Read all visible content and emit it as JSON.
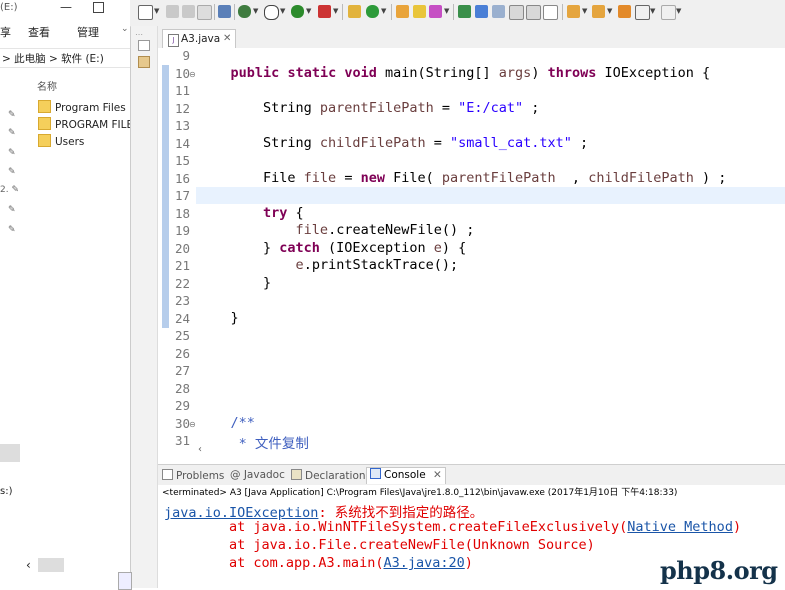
{
  "explorer": {
    "title": "(E:)",
    "ribbon": [
      "享",
      "查看",
      "管理"
    ],
    "breadcrumb": "> 此电脑 > 软件 (E:)",
    "column_name": "名称",
    "folders": [
      "Program Files",
      "PROGRAM FILES",
      "Users"
    ],
    "side_label_2": "2.",
    "side_label_s": "s:)"
  },
  "editor": {
    "tab_label": "A3.java",
    "lines": [
      {
        "n": "9",
        "code": ""
      },
      {
        "n": "10",
        "code": "public static void main(String[] args) throws IOException {"
      },
      {
        "n": "11",
        "code": ""
      },
      {
        "n": "12",
        "code": "    String parentFilePath = \"E:/cat\" ;"
      },
      {
        "n": "13",
        "code": ""
      },
      {
        "n": "14",
        "code": "    String childFilePath = \"small_cat.txt\" ;"
      },
      {
        "n": "15",
        "code": ""
      },
      {
        "n": "16",
        "code": "    File file = new File( parentFilePath  , childFilePath ) ;"
      },
      {
        "n": "17",
        "code": ""
      },
      {
        "n": "18",
        "code": "    try {"
      },
      {
        "n": "19",
        "code": "        file.createNewFile() ;"
      },
      {
        "n": "20",
        "code": "    } catch (IOException e) {"
      },
      {
        "n": "21",
        "code": "        e.printStackTrace();"
      },
      {
        "n": "22",
        "code": "    }"
      },
      {
        "n": "23",
        "code": ""
      },
      {
        "n": "24",
        "code": "}"
      },
      {
        "n": "25",
        "code": ""
      },
      {
        "n": "26",
        "code": ""
      },
      {
        "n": "27",
        "code": ""
      },
      {
        "n": "28",
        "code": ""
      },
      {
        "n": "29",
        "code": ""
      },
      {
        "n": "30",
        "code": "/**"
      },
      {
        "n": "31",
        "code": " * 文件复制"
      }
    ]
  },
  "console": {
    "tabs": {
      "problems": "Problems",
      "javadoc": "@ Javadoc",
      "declaration": "Declaration",
      "console": "Console"
    },
    "status": "<terminated> A3 [Java Application] C:\\Program Files\\Java\\jre1.8.0_112\\bin\\javaw.exe (2017年1月10日 下午4:18:33)",
    "exception_class": "java.io.IOException",
    "exception_msg": ": 系统找不到指定的路径。",
    "trace1_prefix": "        at java.io.WinNTFileSystem.createFileExclusively(",
    "trace1_link": "Native Method",
    "trace1_suffix": ")",
    "trace2": "        at java.io.File.createNewFile(Unknown Source)",
    "trace3_prefix": "        at com.app.A3.main(",
    "trace3_link": "A3.java:20",
    "trace3_suffix": ")"
  },
  "watermark": "php8.org"
}
